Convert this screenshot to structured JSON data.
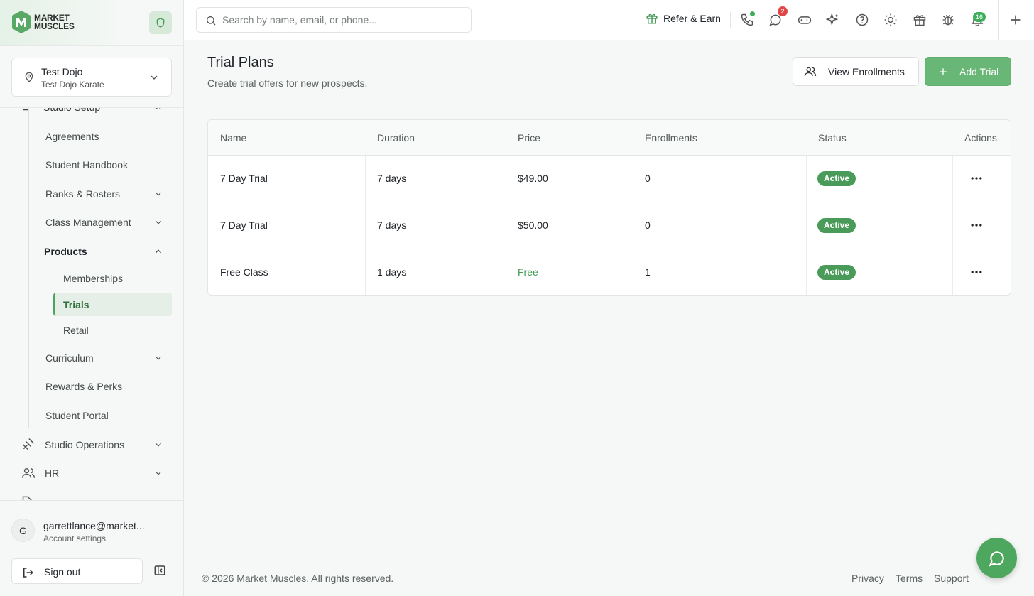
{
  "brand": {
    "name_line1": "MARKET",
    "name_line2": "MUSCLES"
  },
  "location": {
    "name": "Test Dojo",
    "subtitle": "Test Dojo Karate"
  },
  "sidebar": {
    "section_partial": "Studio Setup",
    "items": [
      {
        "label": "Agreements"
      },
      {
        "label": "Student Handbook"
      },
      {
        "label": "Ranks & Rosters"
      },
      {
        "label": "Class Management"
      },
      {
        "label": "Products"
      },
      {
        "label": "Memberships"
      },
      {
        "label": "Trials"
      },
      {
        "label": "Retail"
      },
      {
        "label": "Curriculum"
      },
      {
        "label": "Rewards & Perks"
      },
      {
        "label": "Student Portal"
      },
      {
        "label": "Studio Operations"
      },
      {
        "label": "HR"
      }
    ]
  },
  "account": {
    "initial": "G",
    "email": "garrettlance@market...",
    "settings_label": "Account settings",
    "signout_label": "Sign out"
  },
  "header": {
    "search_placeholder": "Search by name, email, or phone...",
    "refer_label": "Refer & Earn",
    "messages_badge": "2",
    "notifications_badge": "16"
  },
  "page": {
    "title": "Trial Plans",
    "subtitle": "Create trial offers for new prospects.",
    "view_enrollments_label": "View Enrollments",
    "add_trial_label": "Add Trial"
  },
  "table": {
    "columns": [
      "Name",
      "Duration",
      "Price",
      "Enrollments",
      "Status",
      "Actions"
    ],
    "rows": [
      {
        "name": "7 Day Trial",
        "duration": "7 days",
        "price": "$49.00",
        "enrollments": "0",
        "status": "Active"
      },
      {
        "name": "7 Day Trial",
        "duration": "7 days",
        "price": "$50.00",
        "enrollments": "0",
        "status": "Active"
      },
      {
        "name": "Free Class",
        "duration": "1 days",
        "price": "Free",
        "enrollments": "1",
        "status": "Active"
      }
    ]
  },
  "footer": {
    "copyright": "© 2026 Market Muscles. All rights reserved.",
    "links": [
      "Privacy",
      "Terms",
      "Support"
    ]
  },
  "colors": {
    "accent": "#69b776",
    "status_active": "#4a9b59",
    "free_text": "#3f9a52"
  }
}
